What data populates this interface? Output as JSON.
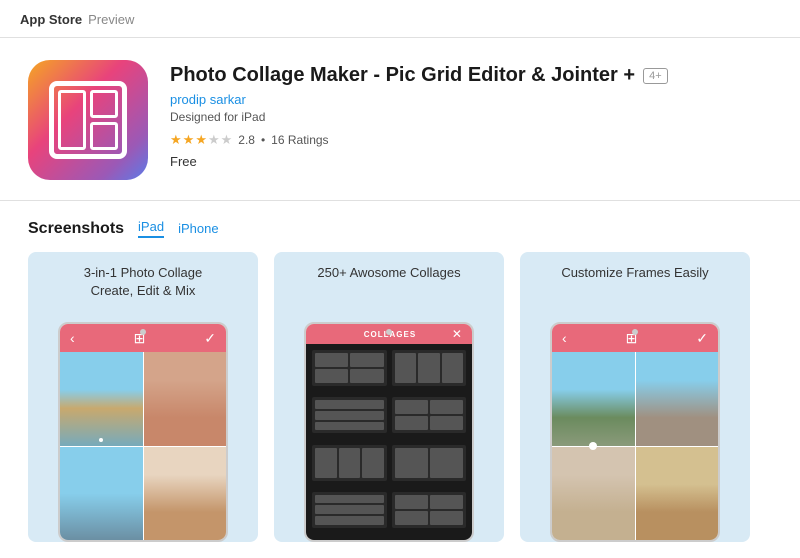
{
  "header": {
    "appstore_label": "App Store",
    "preview_label": "Preview"
  },
  "app": {
    "title": "Photo Collage Maker - Pic Grid Editor & Jointer +",
    "age_badge": "4+",
    "developer": "prodip sarkar",
    "designed_for": "Designed for iPad",
    "rating_value": "2.8",
    "rating_count": "16 Ratings",
    "price": "Free"
  },
  "screenshots": {
    "section_title": "Screenshots",
    "tab_ipad": "iPad",
    "tab_iphone": "iPhone",
    "cards": [
      {
        "caption": "3-in-1 Photo Collage\nCreate, Edit & Mix"
      },
      {
        "caption": "250+ Awosome Collages"
      },
      {
        "caption": "Customize Frames Easily"
      }
    ]
  }
}
